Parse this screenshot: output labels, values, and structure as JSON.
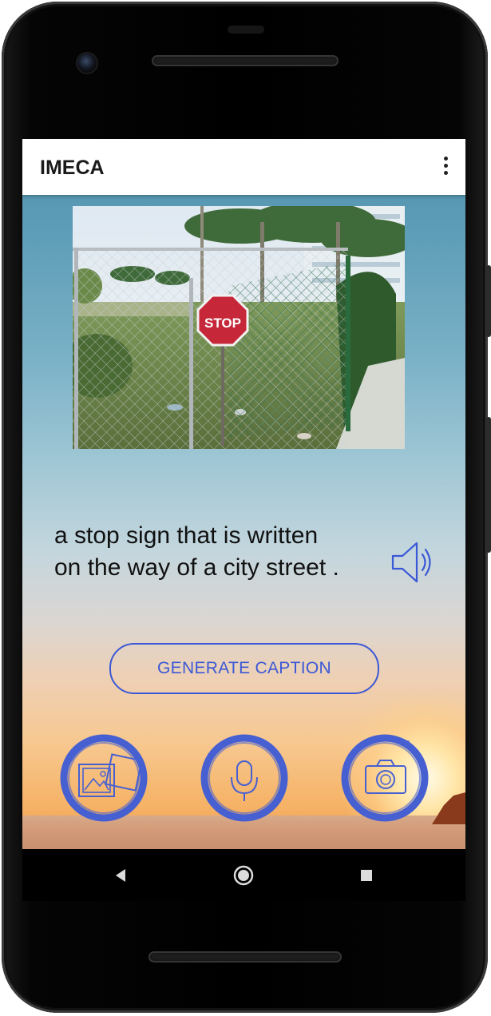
{
  "app": {
    "title": "IMECA"
  },
  "appbar": {
    "menu_icon": "more-vert-icon"
  },
  "image": {
    "subject": "photo",
    "sign_text": "STOP"
  },
  "caption": {
    "line1": "a stop sign that is written",
    "line2": "on the way of a city street ."
  },
  "buttons": {
    "generate_label": "GENERATE CAPTION",
    "gallery_icon": "gallery-icon",
    "mic_icon": "microphone-icon",
    "camera_icon": "camera-icon",
    "speaker_icon": "speaker-icon"
  },
  "navbar": {
    "back_icon": "back-icon",
    "home_icon": "home-icon",
    "recents_icon": "recents-icon"
  },
  "colors": {
    "accent": "#3b58d6",
    "appbar": "#ffffff",
    "navbar": "#000000"
  }
}
